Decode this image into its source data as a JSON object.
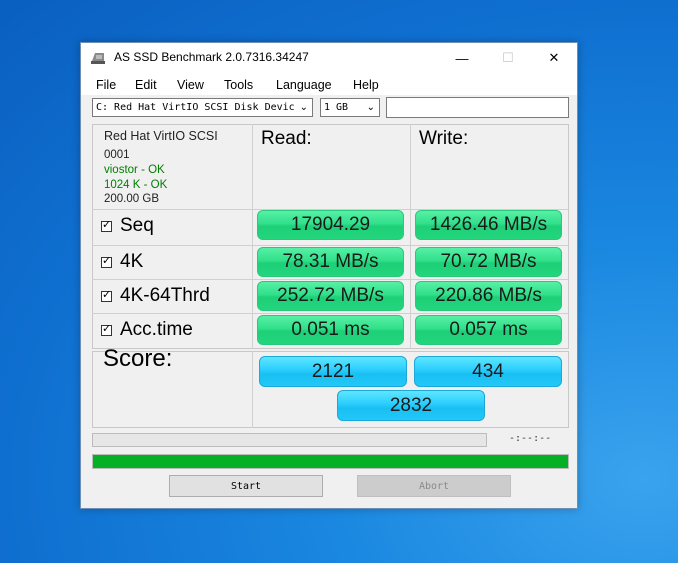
{
  "window": {
    "title": "AS SSD Benchmark 2.0.7316.34247",
    "minimize_glyph": "—",
    "maximize_glyph": "☐",
    "close_glyph": "✕",
    "icon": "disk-icon"
  },
  "menu": [
    "File",
    "Edit",
    "View",
    "Tools",
    "Language",
    "Help"
  ],
  "toolbar": {
    "drive_selected": "C: Red Hat VirtIO SCSI Disk Devic",
    "size_selected": "1 GB",
    "dropdown_glyph": "⌄",
    "text_value": ""
  },
  "drive_info": {
    "name": "Red Hat VirtIO SCSI",
    "firmware": "0001",
    "driver": "viostor - OK",
    "alignment": "1024 K - OK",
    "capacity": "200.00 GB",
    "ok_color": "#008000"
  },
  "headers": {
    "read": "Read:",
    "write": "Write:"
  },
  "rows": [
    {
      "label": "Seq",
      "checked": true,
      "read": "17904.29",
      "write": "1426.46 MB/s"
    },
    {
      "label": "4K",
      "checked": true,
      "read": "78.31 MB/s",
      "write": "70.72 MB/s"
    },
    {
      "label": "4K-64Thrd",
      "checked": true,
      "read": "252.72 MB/s",
      "write": "220.86 MB/s"
    },
    {
      "label": "Acc.time",
      "checked": true,
      "read": "0.051 ms",
      "write": "0.057 ms"
    }
  ],
  "score": {
    "label": "Score:",
    "read": "2121",
    "write": "434",
    "total": "2832"
  },
  "progress": {
    "time": "-:--:--",
    "small_fraction": 0,
    "big_fraction": 1.0,
    "fill_color": "#06b025"
  },
  "buttons": {
    "start": "Start",
    "abort": "Abort"
  },
  "colors": {
    "result_green": "#30e08a",
    "score_blue": "#2fd0ff"
  }
}
